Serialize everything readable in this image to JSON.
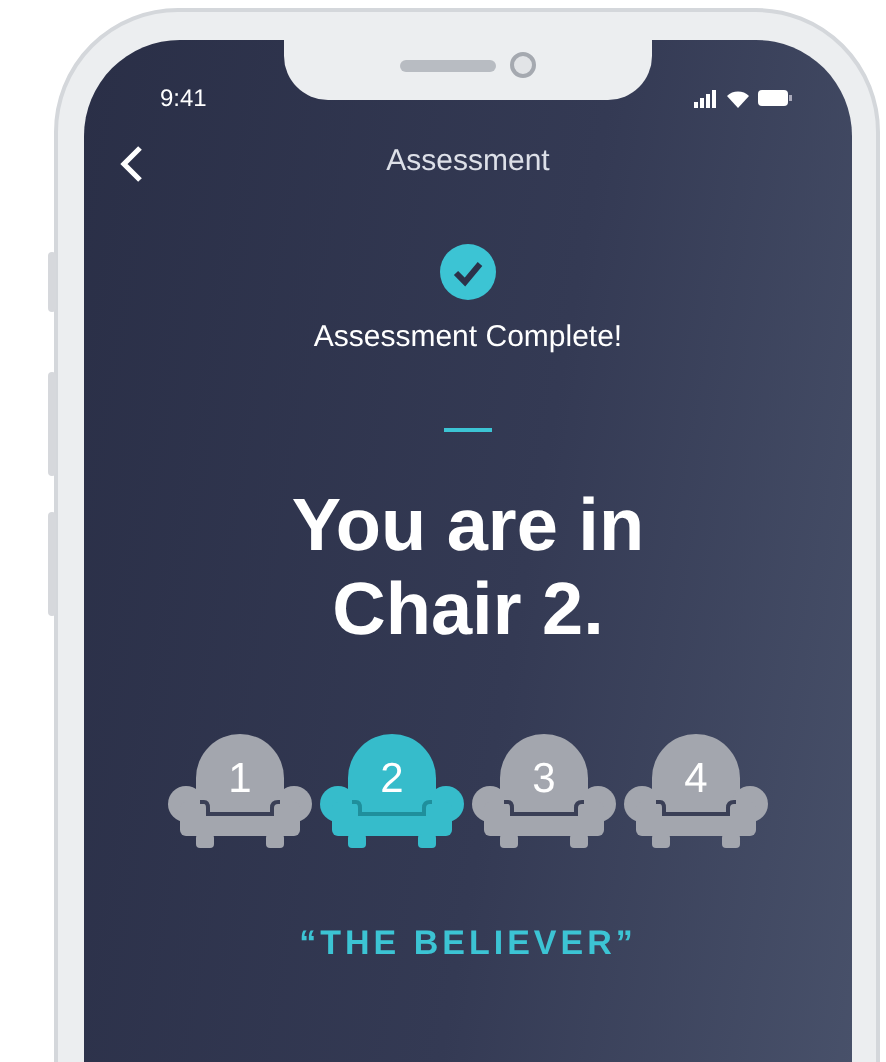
{
  "status_bar": {
    "time": "9:41"
  },
  "nav": {
    "title": "Assessment"
  },
  "result": {
    "status": "Assessment Complete!",
    "headline": "You are in Chair 2.",
    "chairs": [
      {
        "number": "1",
        "selected": false
      },
      {
        "number": "2",
        "selected": true
      },
      {
        "number": "3",
        "selected": false
      },
      {
        "number": "4",
        "selected": false
      }
    ],
    "label": "“THE BELIEVER”"
  }
}
